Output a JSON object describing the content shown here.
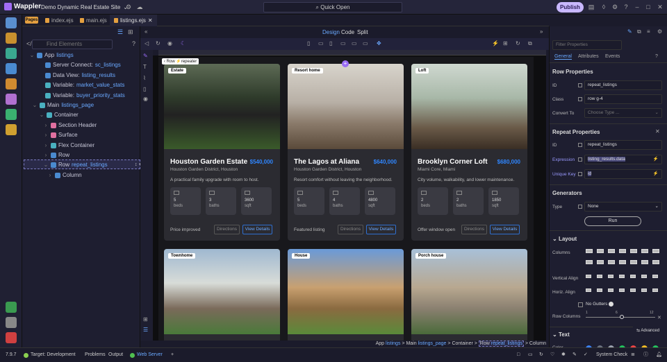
{
  "app": {
    "name": "Wappler",
    "project": "Demo Dynamic Real Estate Site",
    "quick_open": "Quick Open",
    "publish": "Publish"
  },
  "tabs": {
    "pages_badge": "Pages",
    "items": [
      "index.ejs",
      "main.ejs",
      "listings.ejs"
    ]
  },
  "structure": {
    "find_placeholder": "Find Elements",
    "nodes": [
      {
        "label": "App",
        "hl": "listings"
      },
      {
        "label": "Server Connect:",
        "hl": "sc_listings"
      },
      {
        "label": "Data View:",
        "hl": "listing_results"
      },
      {
        "label": "Variable:",
        "hl": "market_value_stats"
      },
      {
        "label": "Variable:",
        "hl": "buyer_priority_stats"
      },
      {
        "label": "Main",
        "hl": "listings_page"
      },
      {
        "label": "Container",
        "hl": ""
      },
      {
        "label": "Section Header",
        "hl": ""
      },
      {
        "label": "Surface",
        "hl": ""
      },
      {
        "label": "Flex Container",
        "hl": ""
      },
      {
        "label": "Row",
        "hl": ""
      },
      {
        "label": "Row",
        "hl": "repeat_listings"
      },
      {
        "label": "Column",
        "hl": ""
      }
    ]
  },
  "design": {
    "tabs": [
      "Design",
      "Code",
      "Split"
    ],
    "row_label": "Row",
    "repeater": "repeater"
  },
  "cards": [
    {
      "tag": "Estate",
      "title": "Houston Garden Estate",
      "price": "$540,000",
      "location": "Houston Garden District, Houston",
      "desc": "A practical family upgrade with room to host.",
      "beds": "5",
      "baths": "3",
      "sqft": "3600",
      "note": "Price improved"
    },
    {
      "tag": "Resort home",
      "title": "The Lagos at Aliana",
      "price": "$640,000",
      "location": "Houston Garden District, Houston",
      "desc": "Resort comfort without leaving the neighborhood.",
      "beds": "5",
      "baths": "4",
      "sqft": "4800",
      "note": "Featured listing"
    },
    {
      "tag": "Loft",
      "title": "Brooklyn Corner Loft",
      "price": "$680,000",
      "location": "Miami Core, Miami",
      "desc": "City volume, walkability, and lower maintenance.",
      "beds": "2",
      "baths": "2",
      "sqft": "1850",
      "note": "Offer window open"
    },
    {
      "tag": "Townhome"
    },
    {
      "tag": "House"
    },
    {
      "tag": "Porch house"
    }
  ],
  "card_labels": {
    "beds": "beds",
    "baths": "baths",
    "sqft": "sqft",
    "directions": "Directions",
    "view": "View Details"
  },
  "breadcrumb": {
    "app": "App",
    "app_hl": "listings",
    "main": "Main",
    "main_hl": "listings_page",
    "container": "Container",
    "row": "Row",
    "row_hl": "repeat_listings",
    "column": "Column"
  },
  "properties": {
    "filter_placeholder": "Filter Properties",
    "tabs": [
      "General",
      "Attributes",
      "Events"
    ],
    "row_props": "Row Properties",
    "id_label": "ID",
    "id_value": "repeat_listings",
    "class_label": "Class",
    "class_value": "row g-4",
    "convert_label": "Convert To",
    "convert_placeholder": "Choose Type ...",
    "repeat_props": "Repeat Properties",
    "r_id_value": "repeat_listings",
    "expr_label": "Expression",
    "expr_value": "listing_results.data",
    "unique_label": "Unique Key",
    "unique_value": "id",
    "generators": "Generators",
    "type_label": "Type",
    "type_value": "None",
    "run": "Run",
    "layout": "Layout",
    "columns_label": "Columns",
    "valign_label": "Vertical Align",
    "halign_label": "Horiz. Align",
    "nogutters": "No Gutters",
    "rowcols_label": "Row Columns",
    "slider_ticks": [
      "1",
      "6",
      "12"
    ],
    "advanced": "Advanced",
    "text": "Text",
    "color_label": "Color"
  },
  "status": {
    "version": "7.9.7",
    "target": "Target: Development",
    "problems": "Problems",
    "output": "Output",
    "webserver": "Web Server",
    "syscheck": "System Check"
  },
  "colors": {
    "accent": "#9a6cf5",
    "link": "#2f86ff",
    "bg": "#1b1b2b"
  },
  "swatches": [
    "#3b82f6",
    "#6b7280",
    "#9ca3af",
    "#22c55e",
    "#ef4444",
    "#fbbf24",
    "#22c55e"
  ]
}
